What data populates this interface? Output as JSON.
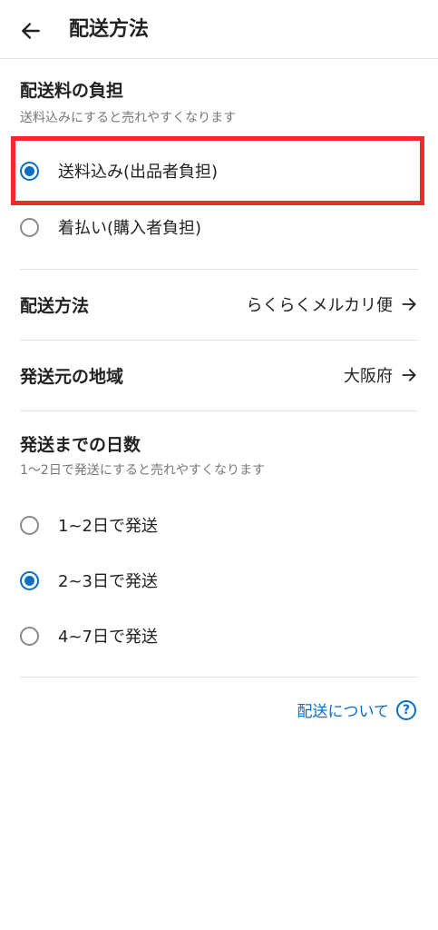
{
  "header": {
    "back_icon": "arrow-left-icon",
    "title": "配送方法"
  },
  "shipping_fee": {
    "title": "配送料の負担",
    "subtitle": "送料込みにすると売れやすくなります",
    "options": [
      {
        "label": "送料込み(出品者負担)",
        "selected": true
      },
      {
        "label": "着払い(購入者負担)",
        "selected": false
      }
    ]
  },
  "shipping_method": {
    "label": "配送方法",
    "value": "らくらくメルカリ便",
    "icon": "arrow-right-icon"
  },
  "ship_from": {
    "label": "発送元の地域",
    "value": "大阪府",
    "icon": "arrow-right-icon"
  },
  "days_to_ship": {
    "title": "発送までの日数",
    "subtitle": "1〜2日で発送にすると売れやすくなります",
    "options": [
      {
        "label": "1~2日で発送",
        "selected": false
      },
      {
        "label": "2~3日で発送",
        "selected": true
      },
      {
        "label": "4~7日で発送",
        "selected": false
      }
    ]
  },
  "help": {
    "label": "配送について",
    "icon": "question-circle-icon",
    "icon_glyph": "?"
  },
  "colors": {
    "accent": "#0a6fc2",
    "highlight": "#ee2a2a",
    "divider": "#e2e2e2"
  }
}
